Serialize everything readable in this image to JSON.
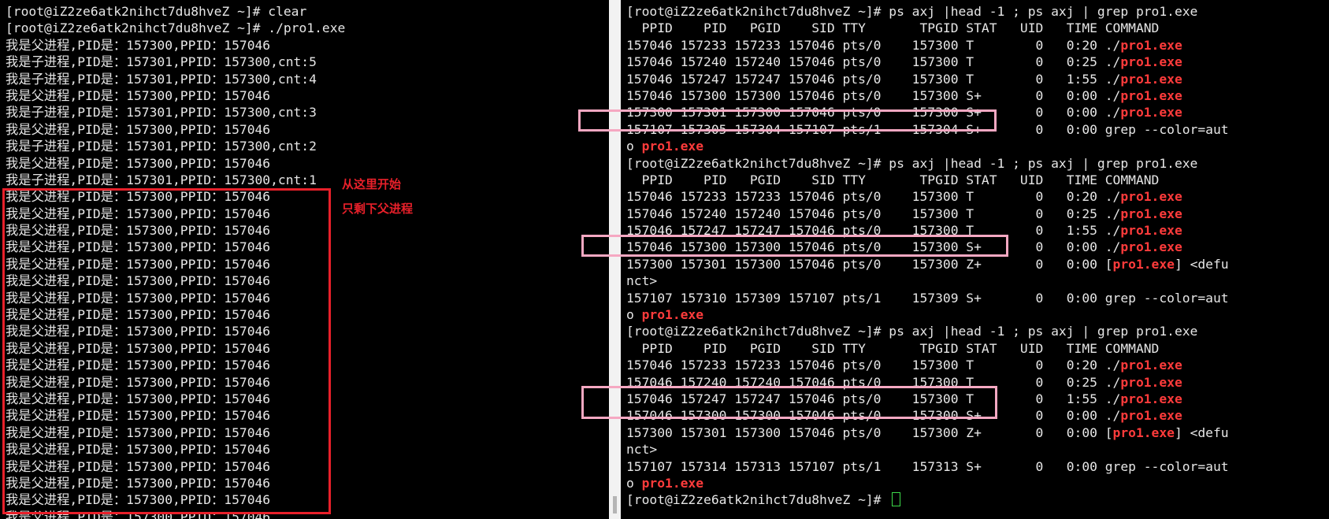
{
  "left_terminal": {
    "lines": [
      "[root@iZ2ze6atk2nihct7du8hveZ ~]# clear",
      "[root@iZ2ze6atk2nihct7du8hveZ ~]# ./pro1.exe",
      "我是父进程,PID是：157300,PPID：157046",
      "我是子进程,PID是：157301,PPID：157300,cnt:5",
      "我是子进程,PID是：157301,PPID：157300,cnt:4",
      "我是父进程,PID是：157300,PPID：157046",
      "我是子进程,PID是：157301,PPID：157300,cnt:3",
      "我是父进程,PID是：157300,PPID：157046",
      "我是子进程,PID是：157301,PPID：157300,cnt:2",
      "我是父进程,PID是：157300,PPID：157046",
      "我是子进程,PID是：157301,PPID：157300,cnt:1",
      "我是父进程,PID是：157300,PPID：157046",
      "我是父进程,PID是：157300,PPID：157046",
      "我是父进程,PID是：157300,PPID：157046",
      "我是父进程,PID是：157300,PPID：157046",
      "我是父进程,PID是：157300,PPID：157046",
      "我是父进程,PID是：157300,PPID：157046",
      "我是父进程,PID是：157300,PPID：157046",
      "我是父进程,PID是：157300,PPID：157046",
      "我是父进程,PID是：157300,PPID：157046",
      "我是父进程,PID是：157300,PPID：157046",
      "我是父进程,PID是：157300,PPID：157046",
      "我是父进程,PID是：157300,PPID：157046",
      "我是父进程,PID是：157300,PPID：157046",
      "我是父进程,PID是：157300,PPID：157046",
      "我是父进程,PID是：157300,PPID：157046",
      "我是父进程,PID是：157300,PPID：157046",
      "我是父进程,PID是：157300,PPID：157046",
      "我是父进程,PID是：157300,PPID：157046",
      "我是父进程,PID是：157300,PPID：157046",
      "我是父进程,PID是：157300,PPID：157046"
    ],
    "annotation": [
      "从这里开始",
      "只剩下父进程"
    ]
  },
  "right_terminal": {
    "lines": [
      [
        {
          "t": "[root@iZ2ze6atk2nihct7du8hveZ ~]# ps axj |head -1 ; ps axj | grep pro1.exe"
        }
      ],
      [
        {
          "t": "  PPID    PID   PGID    SID TTY       TPGID STAT   UID   TIME COMMAND"
        }
      ],
      [
        {
          "t": "157046 157233 157233 157046 pts/0    157300 T        0   0:20 ./"
        },
        {
          "t": "pro1.exe",
          "hl": true
        }
      ],
      [
        {
          "t": "157046 157240 157240 157046 pts/0    157300 T        0   0:25 ./"
        },
        {
          "t": "pro1.exe",
          "hl": true
        }
      ],
      [
        {
          "t": "157046 157247 157247 157046 pts/0    157300 T        0   1:55 ./"
        },
        {
          "t": "pro1.exe",
          "hl": true
        }
      ],
      [
        {
          "t": "157046 157300 157300 157046 pts/0    157300 S+       0   0:00 ./"
        },
        {
          "t": "pro1.exe",
          "hl": true
        }
      ],
      [
        {
          "t": "157300 157301 157300 157046 pts/0    157300 S+       0   0:00 ./"
        },
        {
          "t": "pro1.exe",
          "hl": true
        }
      ],
      [
        {
          "t": "157107 157305 157304 157107 pts/1    157304 S+       0   0:00 grep --color=aut"
        }
      ],
      [
        {
          "t": "o "
        },
        {
          "t": "pro1.exe",
          "hl": true
        }
      ],
      [
        {
          "t": "[root@iZ2ze6atk2nihct7du8hveZ ~]# ps axj |head -1 ; ps axj | grep pro1.exe"
        }
      ],
      [
        {
          "t": "  PPID    PID   PGID    SID TTY       TPGID STAT   UID   TIME COMMAND"
        }
      ],
      [
        {
          "t": "157046 157233 157233 157046 pts/0    157300 T        0   0:20 ./"
        },
        {
          "t": "pro1.exe",
          "hl": true
        }
      ],
      [
        {
          "t": "157046 157240 157240 157046 pts/0    157300 T        0   0:25 ./"
        },
        {
          "t": "pro1.exe",
          "hl": true
        }
      ],
      [
        {
          "t": "157046 157247 157247 157046 pts/0    157300 T        0   1:55 ./"
        },
        {
          "t": "pro1.exe",
          "hl": true
        }
      ],
      [
        {
          "t": "157046 157300 157300 157046 pts/0    157300 S+       0   0:00 ./"
        },
        {
          "t": "pro1.exe",
          "hl": true
        }
      ],
      [
        {
          "t": "157300 157301 157300 157046 pts/0    157300 Z+       0   0:00 ["
        },
        {
          "t": "pro1.exe",
          "hl": true
        },
        {
          "t": "] <defu"
        }
      ],
      [
        {
          "t": "nct>"
        }
      ],
      [
        {
          "t": "157107 157310 157309 157107 pts/1    157309 S+       0   0:00 grep --color=aut"
        }
      ],
      [
        {
          "t": "o "
        },
        {
          "t": "pro1.exe",
          "hl": true
        }
      ],
      [
        {
          "t": "[root@iZ2ze6atk2nihct7du8hveZ ~]# ps axj |head -1 ; ps axj | grep pro1.exe"
        }
      ],
      [
        {
          "t": "  PPID    PID   PGID    SID TTY       TPGID STAT   UID   TIME COMMAND"
        }
      ],
      [
        {
          "t": "157046 157233 157233 157046 pts/0    157300 T        0   0:20 ./"
        },
        {
          "t": "pro1.exe",
          "hl": true
        }
      ],
      [
        {
          "t": "157046 157240 157240 157046 pts/0    157300 T        0   0:25 ./"
        },
        {
          "t": "pro1.exe",
          "hl": true
        }
      ],
      [
        {
          "t": "157046 157247 157247 157046 pts/0    157300 T        0   1:55 ./"
        },
        {
          "t": "pro1.exe",
          "hl": true
        }
      ],
      [
        {
          "t": "157046 157300 157300 157046 pts/0    157300 S+       0   0:00 ./"
        },
        {
          "t": "pro1.exe",
          "hl": true
        }
      ],
      [
        {
          "t": "157300 157301 157300 157046 pts/0    157300 Z+       0   0:00 ["
        },
        {
          "t": "pro1.exe",
          "hl": true
        },
        {
          "t": "] <defu"
        }
      ],
      [
        {
          "t": "nct>"
        }
      ],
      [
        {
          "t": "157107 157314 157313 157107 pts/1    157313 S+       0   0:00 grep --color=aut"
        }
      ],
      [
        {
          "t": "o "
        },
        {
          "t": "pro1.exe",
          "hl": true
        }
      ],
      [
        {
          "t": "[root@iZ2ze6atk2nihct7du8hveZ ~]# "
        }
      ]
    ]
  },
  "colors": {
    "terminal_bg": "#000000",
    "terminal_fg": "#e6e6e6",
    "highlight": "#ff3b3b",
    "annotation_red": "#e8202a",
    "annotation_pink": "#f6a8c2",
    "cursor": "#3ddc4a"
  }
}
